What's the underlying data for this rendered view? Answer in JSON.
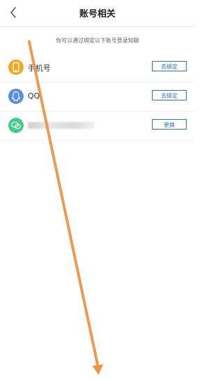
{
  "header": {
    "title": "账号相关"
  },
  "hint": "你可以通过绑定以下账号登录知聊",
  "rows": [
    {
      "label": "手机号",
      "button": "去绑定",
      "icon": "phone-icon",
      "color": "#f3a61f"
    },
    {
      "label": "QQ",
      "button": "去绑定",
      "icon": "qq-icon",
      "color": "#5b8ee0"
    },
    {
      "label": "",
      "button": "更换",
      "icon": "wechat-icon",
      "color": "#48c98c"
    }
  ],
  "annotation": {
    "color": "#ee8f3e"
  }
}
